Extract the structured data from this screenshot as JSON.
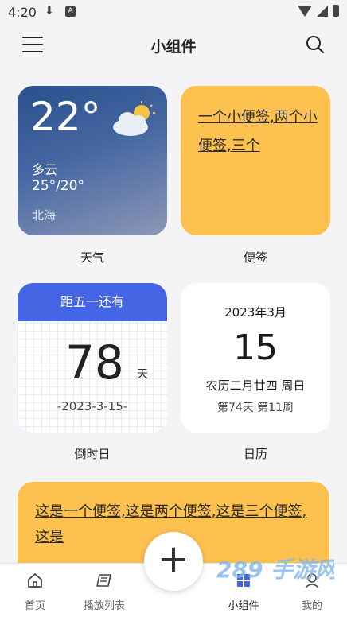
{
  "status_bar": {
    "time": "4:20",
    "a_badge": "A"
  },
  "app_bar": {
    "title": "小组件"
  },
  "weather": {
    "temp": "22°",
    "condition": "多云",
    "range": "25°/20°",
    "city": "北海",
    "label": "天气"
  },
  "note_small": {
    "text": "一个小便签,两个小便签,三个",
    "label": "便签"
  },
  "countdown": {
    "header": "距五一还有",
    "days": "78",
    "unit": "天",
    "date": "-2023-3-15-",
    "label": "倒时日"
  },
  "calendar": {
    "year_month": "2023年3月",
    "day": "15",
    "lunar": "农历二月廿四  周日",
    "week": "第74天  第11周",
    "label": "日历"
  },
  "note_large": {
    "text": "这是一个便签,这是两个便签,这是三个便签,这是"
  },
  "tabs": [
    {
      "label": "首页",
      "icon": "home-icon"
    },
    {
      "label": "播放列表",
      "icon": "playlist-icon"
    },
    {
      "label": "小组件",
      "icon": "widget-icon"
    },
    {
      "label": "我的",
      "icon": "profile-icon"
    }
  ],
  "fab": {
    "symbol": "+"
  },
  "watermark": {
    "text": "289 手游网"
  },
  "colors": {
    "accent_blue": "#4566e4",
    "note_yellow": "#fdc150"
  }
}
